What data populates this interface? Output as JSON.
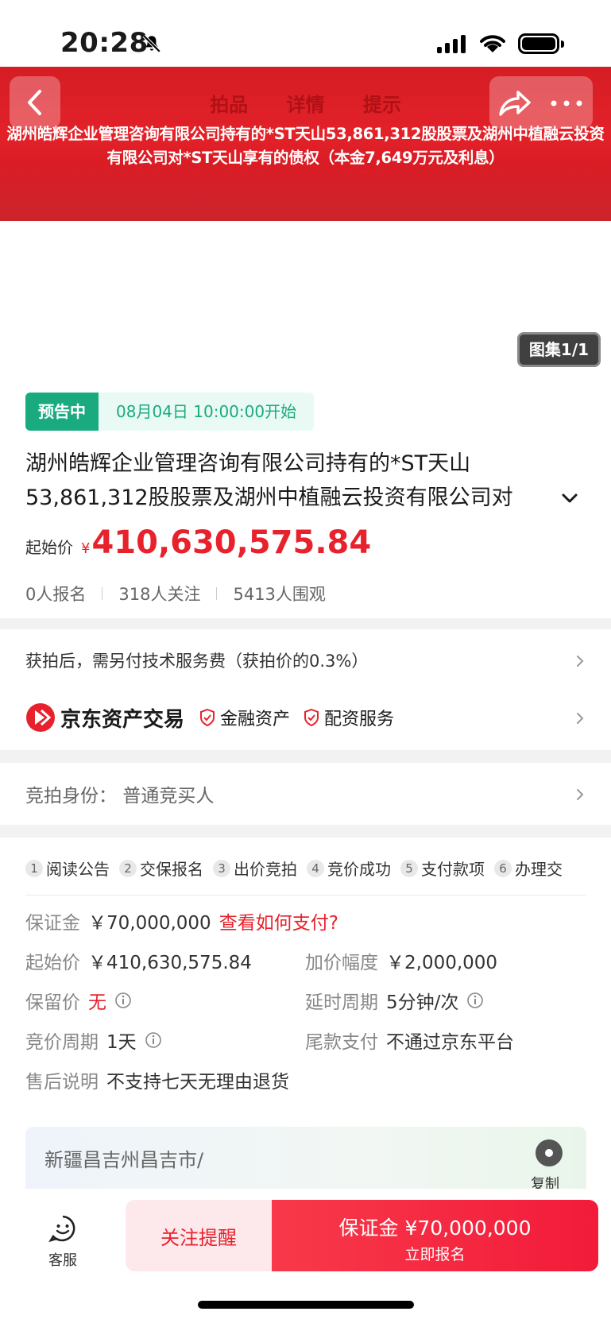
{
  "status_bar": {
    "time": "20:28"
  },
  "header": {
    "tabs": [
      "拍品",
      "详情",
      "提示"
    ],
    "banner_title": "湖州皓辉企业管理咨询有限公司持有的*ST天山53,861,312股股票及湖州中植融云投资有限公司对*ST天山享有的债权（本金7,649万元及利息）"
  },
  "gallery": {
    "album_label": "图集1/1"
  },
  "auction": {
    "status_tag": "预告中",
    "start_time": "08月04日 10:00:00开始",
    "title": "湖州皓辉企业管理咨询有限公司持有的*ST天山53,861,312股股票及湖州中植融云投资有限公司对",
    "price_label": "起始价",
    "currency": "¥",
    "start_price": "410,630,575.84",
    "stats": [
      "0人报名",
      "318人关注",
      "5413人围观"
    ]
  },
  "service": {
    "fee_notice": "获拍后，需另付技术服务费（获拍价的0.3%）",
    "brand_name": "京东资产交易",
    "badges": [
      "金融资产",
      "配资服务"
    ]
  },
  "identity": {
    "label": "竞拍身份：",
    "value": "普通竞买人"
  },
  "steps": [
    {
      "n": "1",
      "label": "阅读公告"
    },
    {
      "n": "2",
      "label": "交保报名"
    },
    {
      "n": "3",
      "label": "出价竞拍"
    },
    {
      "n": "4",
      "label": "竞价成功"
    },
    {
      "n": "5",
      "label": "支付款项"
    },
    {
      "n": "6",
      "label": "办理交"
    }
  ],
  "rules": {
    "deposit_label": "保证金",
    "deposit_value": "￥70,000,000",
    "deposit_link": "查看如何支付?",
    "start_label": "起始价",
    "start_value": "￥410,630,575.84",
    "increment_label": "加价幅度",
    "increment_value": "￥2,000,000",
    "reserve_label": "保留价",
    "reserve_value": "无",
    "delay_label": "延时周期",
    "delay_value": "5分钟/次",
    "period_label": "竞价周期",
    "period_value": "1天",
    "payment_label": "尾款支付",
    "payment_value": "不通过京东平台",
    "aftersale_label": "售后说明",
    "aftersale_value": "不支持七天无理由退货"
  },
  "address": {
    "text": "新疆昌吉州昌吉市/",
    "copy_label": "复制"
  },
  "bottom_bar": {
    "service_label": "客服",
    "follow_label": "关注提醒",
    "enroll_line1": "保证金 ¥70,000,000",
    "enroll_line2": "立即报名"
  },
  "colors": {
    "accent_red": "#e8222c",
    "status_green": "#1aaa80",
    "banner_red": "#e32129"
  }
}
